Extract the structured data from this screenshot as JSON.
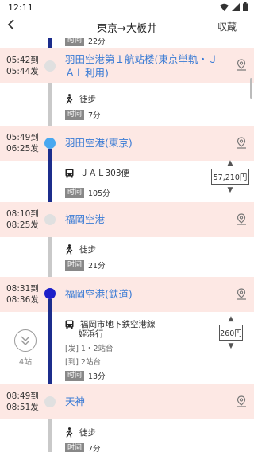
{
  "status_bar": {
    "time": "12:11"
  },
  "nav": {
    "title": "東京→大板井",
    "favorite": "収蔵"
  },
  "top_partial": {
    "tag": "时间",
    "duration": "22分"
  },
  "stations": [
    {
      "arrive": "05:42到",
      "depart": "05:44发",
      "name": "羽田空港第１航站楼(東京単軌・ＪＡＬ利用)"
    },
    {
      "arrive": "05:49到",
      "depart": "06:25发",
      "name": "羽田空港(東京)"
    },
    {
      "arrive": "08:10到",
      "depart": "08:25发",
      "name": "福岡空港"
    },
    {
      "arrive": "08:31到",
      "depart": "08:36发",
      "name": "福岡空港(鉄道)"
    },
    {
      "arrive": "08:49到",
      "depart": "08:51发",
      "name": "天神"
    }
  ],
  "segments": [
    {
      "mode": "徒步",
      "tag": "时间",
      "duration": "7分"
    },
    {
      "mode": "ＪＡＬ303便",
      "tag": "时间",
      "duration": "105分",
      "fare": "57,210円"
    },
    {
      "mode": "徒步",
      "tag": "时间",
      "duration": "21分"
    },
    {
      "mode": "福岡市地下鉄空港線",
      "mode_sub": "姪浜行",
      "board": "[发] 1・2站台",
      "alight": "[到] 2站台",
      "tag": "时间",
      "duration": "13分",
      "fare": "260円",
      "stops": "4站"
    },
    {
      "mode": "徒步",
      "tag": "时间",
      "duration": "7分"
    }
  ],
  "icons": {
    "back": "chevron-left-icon",
    "pin": "map-pin-icon",
    "walk": "walk-icon",
    "bus": "bus-icon",
    "expand": "double-chevron-down-icon",
    "wifi": "wifi-icon",
    "signal": "signal-icon",
    "battery": "battery-icon"
  },
  "colors": {
    "station_bg": "#fde8e4",
    "station_text": "#3a7bd5",
    "line_navy": "#1c2d8c",
    "line_blue": "#3b8eea",
    "line_gray": "#c9c9c9",
    "node_navy": "#1c1fc9",
    "node_blue": "#48a8f0"
  }
}
